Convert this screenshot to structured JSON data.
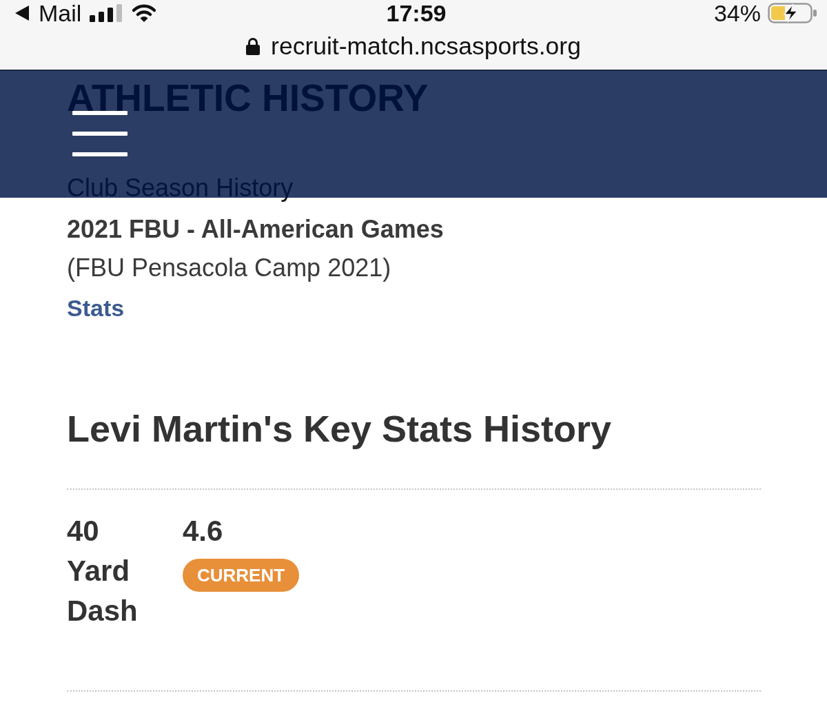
{
  "status_bar": {
    "back_label": "Mail",
    "time": "17:59",
    "battery": "34%"
  },
  "address_bar": {
    "url": "recruit-match.ncsasports.org"
  },
  "page": {
    "section_title": "ATHLETIC HISTORY",
    "subsection_title": "Club Season History",
    "events": [
      {
        "title": "2021 FBU - All-American Games",
        "subtitle": "(FBU Pensacola Camp 2021)",
        "link": "Stats"
      }
    ],
    "key_stats": {
      "heading": "Levi Martin's Key Stats History",
      "rows": [
        {
          "label": "40 Yard Dash",
          "value": "4.6",
          "badge": "CURRENT"
        }
      ]
    }
  }
}
